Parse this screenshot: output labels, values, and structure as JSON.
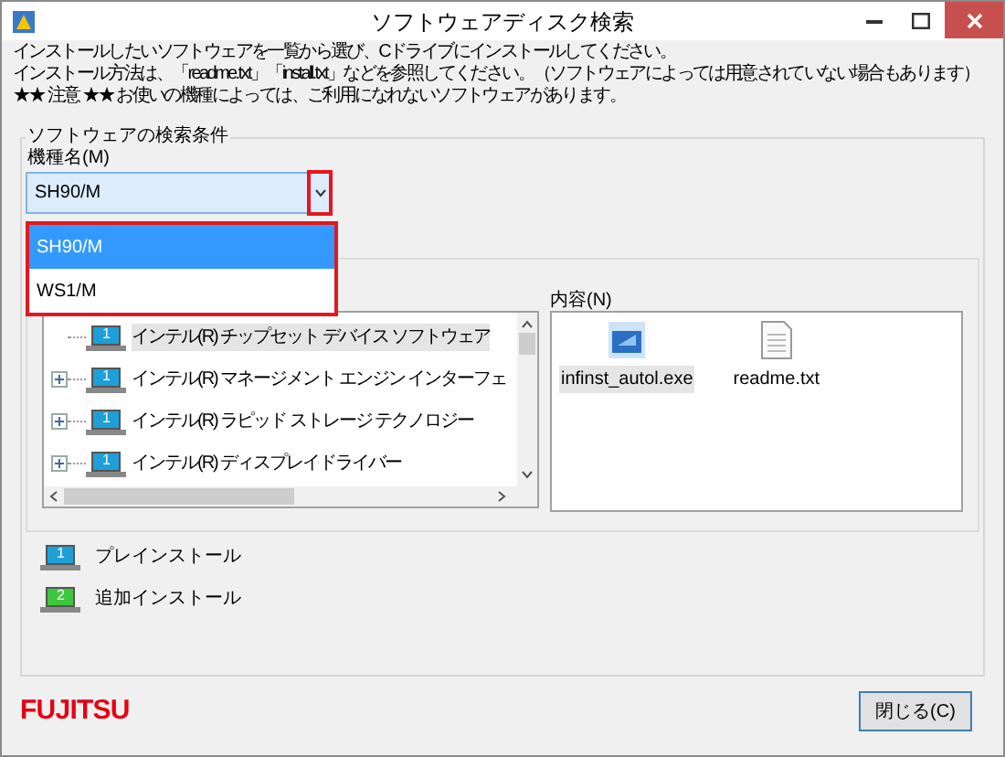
{
  "window": {
    "title": "ソフトウェアディスク検索"
  },
  "instructions": [
    "インストールしたいソフトウェアを一覧から選び、Cドライブにインストールしてください。",
    "インストール方法は、「readme.txt」「install.txt」などを参照してください。（ソフトウェアによっては用意されていない場合もあります）",
    "★★ 注意 ★★ お使いの機種によっては、ご利用になれないソフトウェアがあります。"
  ],
  "search_group": {
    "title": "ソフトウェアの検索条件",
    "model_label": "機種名(M)",
    "model_value": "SH90/M",
    "dropdown": {
      "expanded": true,
      "options": [
        {
          "label": "SH90/M",
          "selected": true
        },
        {
          "label": "WS1/M",
          "selected": false
        }
      ]
    }
  },
  "tree": {
    "items": [
      {
        "label": "インテル(R) チップセット デバイス ソフトウェア",
        "badge": "1",
        "expandable": false,
        "selected": true
      },
      {
        "label": "インテル(R) マネージメント エンジン インターフェ",
        "badge": "1",
        "expandable": true,
        "selected": false
      },
      {
        "label": "インテル(R) ラピッド ストレージ テクノロジー",
        "badge": "1",
        "expandable": true,
        "selected": false
      },
      {
        "label": "インテル(R) ディスプレイドライバー",
        "badge": "1",
        "expandable": true,
        "selected": false
      }
    ]
  },
  "contents": {
    "label": "内容(N)",
    "files": [
      {
        "name": "infinst_autol.exe",
        "kind": "exe",
        "selected": true
      },
      {
        "name": "readme.txt",
        "kind": "txt",
        "selected": false
      }
    ]
  },
  "legend": [
    {
      "badge": "1",
      "label": "プレインストール",
      "color": "#1e9fd8"
    },
    {
      "badge": "2",
      "label": "追加インストール",
      "color": "#3cc83c"
    }
  ],
  "logo": "FUJITSU",
  "close_button": "閉じる(C)"
}
